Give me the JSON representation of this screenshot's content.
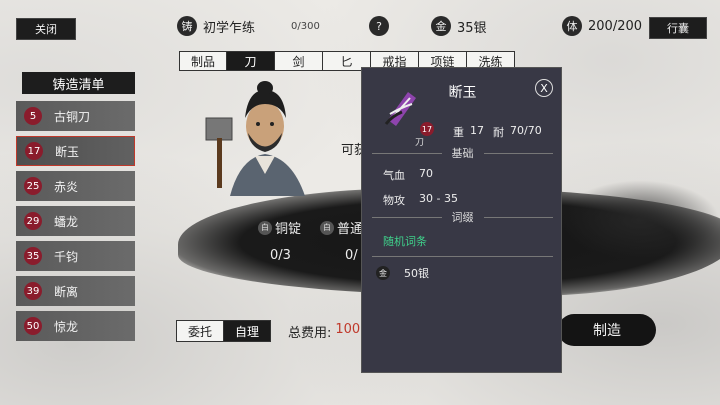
{
  "topbar": {
    "close_label": "关闭",
    "skill_icon": "铸",
    "skill_name": "初学乍练",
    "skill_progress": "0/300",
    "help_icon": "?",
    "gold_icon": "金",
    "gold_value": "35银",
    "stamina_icon": "体",
    "stamina_value": "200/200",
    "bag_label": "行囊"
  },
  "tabs": [
    {
      "label": "制品"
    },
    {
      "label": "刀"
    },
    {
      "label": "剑"
    },
    {
      "label": "匕"
    },
    {
      "label": "戒指"
    },
    {
      "label": "项链"
    },
    {
      "label": "洗练"
    }
  ],
  "active_tab": "刀",
  "recipe_list": {
    "title": "铸造清单",
    "items": [
      {
        "level": "5",
        "name": "古铜刀"
      },
      {
        "level": "17",
        "name": "断玉"
      },
      {
        "level": "25",
        "name": "赤炎"
      },
      {
        "level": "29",
        "name": "蟠龙"
      },
      {
        "level": "35",
        "name": "千钧"
      },
      {
        "level": "39",
        "name": "断离"
      },
      {
        "level": "50",
        "name": "惊龙"
      }
    ]
  },
  "craft": {
    "obtain_text": "可获",
    "material_1_icon": "白",
    "material_1_name": "铜锭",
    "material_1_count": "0/3",
    "material_2_icon": "白",
    "material_2_name": "普通",
    "material_2_count": "0/",
    "mode_entrust": "委托",
    "mode_self": "自理",
    "total_cost_label": "总费用:",
    "total_cost_value": "100",
    "craft_button": "制造"
  },
  "popup": {
    "title": "断玉",
    "close_label": "X",
    "item_level": "17",
    "item_type": "刀",
    "weight_label": "重",
    "weight_value": "17",
    "durability_label": "耐",
    "durability_value": "70/70",
    "base_header": "基础",
    "hp_label": "气血",
    "hp_value": "70",
    "atk_label": "物攻",
    "atk_value": "30 - 35",
    "affix_header": "词缀",
    "random_affix": "随机词条",
    "price_icon": "金",
    "price_value": "50银"
  },
  "colors": {
    "popup_bg": "#383845",
    "affix_green": "#3fd18b",
    "cost_red": "#c0392b",
    "level_badge": "#8a1c2c",
    "item_icon_purple": "#8e44ad"
  }
}
